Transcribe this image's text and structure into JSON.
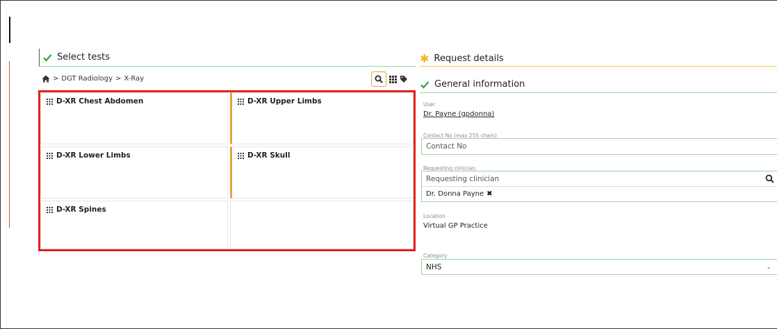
{
  "select_tests": {
    "title": "Select tests",
    "breadcrumb": [
      "DGT Radiology",
      "X-Ray"
    ],
    "separator": ">",
    "tests": [
      {
        "label": "D-XR Chest Abdomen"
      },
      {
        "label": "D-XR Upper Limbs"
      },
      {
        "label": "D-XR Lower Limbs"
      },
      {
        "label": "D-XR Skull"
      },
      {
        "label": "D-XR Spines"
      }
    ]
  },
  "request_details": {
    "title": "Request details",
    "general_information": {
      "title": "General information",
      "user": {
        "label": "User",
        "value": "Dr. Payne (gpdonna)"
      },
      "contact_no": {
        "label": "Contact No (max 255 chars)",
        "placeholder": "Contact No"
      },
      "requesting_clinician": {
        "label": "Requesting clinician",
        "placeholder": "Requesting clinician",
        "selected": "Dr. Donna Payne"
      },
      "location": {
        "label": "Location",
        "value": "Virtual GP Practice"
      },
      "category": {
        "label": "Category",
        "value": "NHS"
      }
    }
  },
  "colors": {
    "check": "#3aa63a",
    "highlight": "#e32020",
    "accent": "#e3a33c",
    "star": "#f2b72a"
  }
}
